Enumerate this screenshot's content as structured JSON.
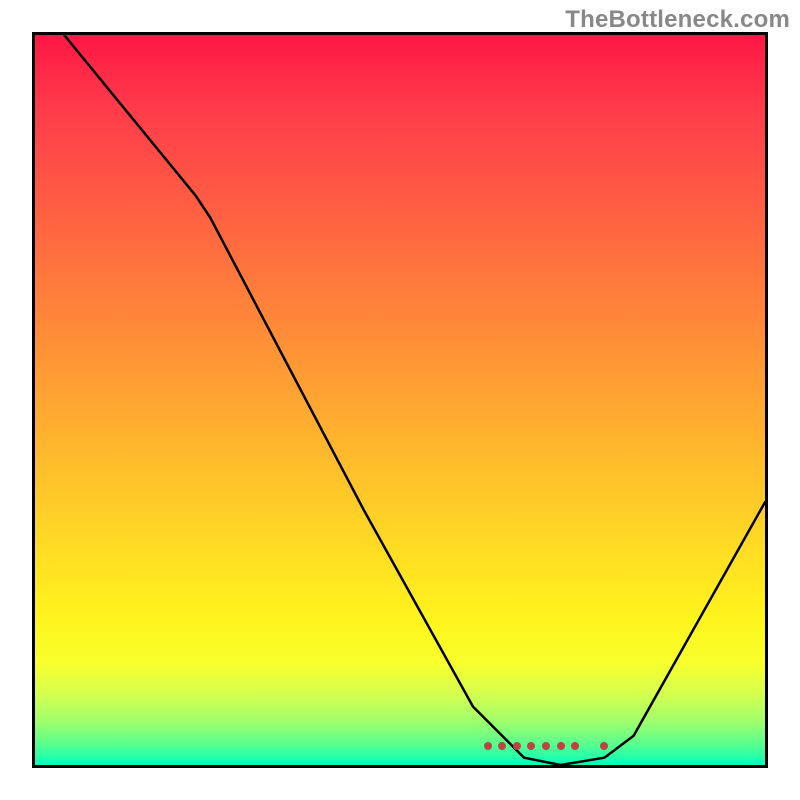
{
  "watermark": "TheBottleneck.com",
  "chart_data": {
    "type": "line",
    "title": "",
    "xlabel": "",
    "ylabel": "",
    "xlim": [
      0,
      100
    ],
    "ylim": [
      0,
      100
    ],
    "grid": false,
    "legend": false,
    "curve": {
      "name": "bottleneck-curve",
      "points": [
        {
          "x": 4,
          "y": 100
        },
        {
          "x": 22,
          "y": 78
        },
        {
          "x": 24,
          "y": 75
        },
        {
          "x": 45,
          "y": 35
        },
        {
          "x": 60,
          "y": 8
        },
        {
          "x": 67,
          "y": 1
        },
        {
          "x": 72,
          "y": 0
        },
        {
          "x": 78,
          "y": 1
        },
        {
          "x": 82,
          "y": 4
        },
        {
          "x": 100,
          "y": 36
        }
      ]
    },
    "markers": {
      "name": "recommended-range",
      "color": "#bf433e",
      "points": [
        {
          "x": 62,
          "y": 2.6
        },
        {
          "x": 64,
          "y": 2.6
        },
        {
          "x": 66,
          "y": 2.6
        },
        {
          "x": 68,
          "y": 2.6
        },
        {
          "x": 70,
          "y": 2.6
        },
        {
          "x": 72,
          "y": 2.6
        },
        {
          "x": 74,
          "y": 2.6
        },
        {
          "x": 78,
          "y": 2.6
        }
      ]
    },
    "background_gradient": {
      "orientation": "vertical",
      "stops": [
        {
          "pos": 0,
          "color": "#ff1744"
        },
        {
          "pos": 50,
          "color": "#ff9a34"
        },
        {
          "pos": 80,
          "color": "#fff41c"
        },
        {
          "pos": 100,
          "color": "#00ffc0"
        }
      ]
    }
  }
}
